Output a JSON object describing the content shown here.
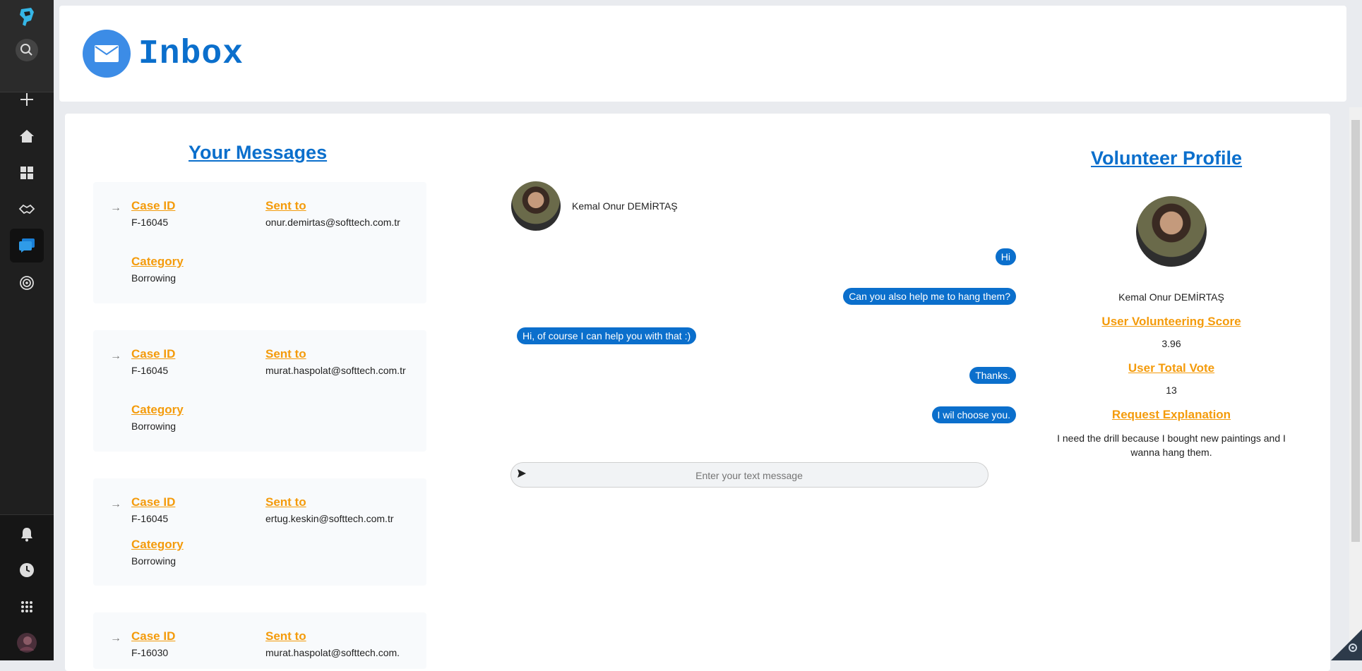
{
  "header": {
    "title": "Inbox"
  },
  "messages_section": {
    "title": "Your Messages"
  },
  "labels": {
    "case_id": "Case ID",
    "sent_to": "Sent to",
    "category": "Category"
  },
  "messages": [
    {
      "case_id": "F-16045",
      "sent_to": "onur.demirtas@softtech.com.tr",
      "category": "Borrowing"
    },
    {
      "case_id": "F-16045",
      "sent_to": "murat.haspolat@softtech.com.tr",
      "category": "Borrowing"
    },
    {
      "case_id": "F-16045",
      "sent_to": "ertug.keskin@softtech.com.tr",
      "category": ""
    },
    {
      "case_id": "F-16030",
      "sent_to": "murat.haspolat@softtech.com.",
      "category": ""
    }
  ],
  "message3_category": "Borrowing",
  "chat": {
    "contact_name": "Kemal Onur DEMİRTAŞ",
    "bubbles": [
      {
        "text": "Hi",
        "side": "right"
      },
      {
        "text": "Can you also help me to hang them?",
        "side": "right"
      },
      {
        "text": "Hi, of course I can help you with that :)",
        "side": "left"
      },
      {
        "text": "Thanks.",
        "side": "right"
      },
      {
        "text": "I wil choose you.",
        "side": "right"
      }
    ],
    "input_placeholder": "Enter your text message"
  },
  "profile": {
    "title": "Volunteer Profile",
    "name": "Kemal Onur DEMİRTAŞ",
    "score_label": "User Volunteering Score",
    "score_value": "3.96",
    "vote_label": "User Total Vote",
    "vote_value": "13",
    "explanation_label": "Request Explanation",
    "explanation_text": "I need the drill because I bought new paintings and I wanna hang them."
  },
  "colors": {
    "accent": "#0b6fcc",
    "label": "#f49b0b",
    "rail": "#1f1f1f"
  },
  "icons": [
    "app-logo-icon",
    "search-icon",
    "plus-icon",
    "home-icon",
    "dashboard-icon",
    "handshake-icon",
    "messages-icon",
    "target-icon",
    "bell-icon",
    "history-icon",
    "apps-grid-icon",
    "user-avatar",
    "mail-icon",
    "send-icon",
    "settings-icon"
  ]
}
